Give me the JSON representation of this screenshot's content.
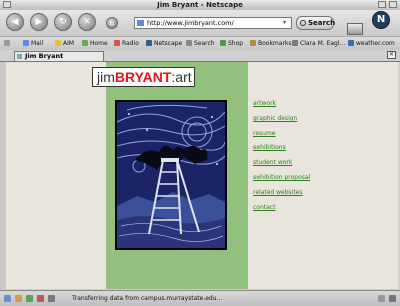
{
  "window": {
    "title": "Jim Bryant - Netscape"
  },
  "toolbar": {
    "url": "http://www.jimbryant.com/",
    "search_label": "Search",
    "throbber_glyph": "N"
  },
  "bookmarks": [
    {
      "label": "Mail",
      "color": "#5b8bd6"
    },
    {
      "label": "AIM",
      "color": "#e8c22a"
    },
    {
      "label": "Home",
      "color": "#6aa84f"
    },
    {
      "label": "Radio",
      "color": "#d9534f"
    },
    {
      "label": "Netscape",
      "color": "#2f5f8f"
    },
    {
      "label": "Search",
      "color": "#888888"
    },
    {
      "label": "Shop",
      "color": "#4a9a4a"
    },
    {
      "label": "Bookmarks",
      "color": "#b98a3a"
    },
    {
      "label": "Clara M. Eagl...",
      "color": "#7a7a7a"
    },
    {
      "label": "weather.com",
      "color": "#3a6ab0"
    }
  ],
  "tab": {
    "label": "Jim Bryant"
  },
  "site": {
    "logo_first": "jim",
    "logo_last": "BRYANT",
    "logo_suffix": ":art",
    "links": [
      "artwork",
      "graphic design",
      "resume",
      "exhibitions",
      "student work",
      "exhibition proposal",
      "related websites",
      "contact"
    ]
  },
  "status": {
    "text": "Transferring data from campus.murraystate.edu..."
  }
}
